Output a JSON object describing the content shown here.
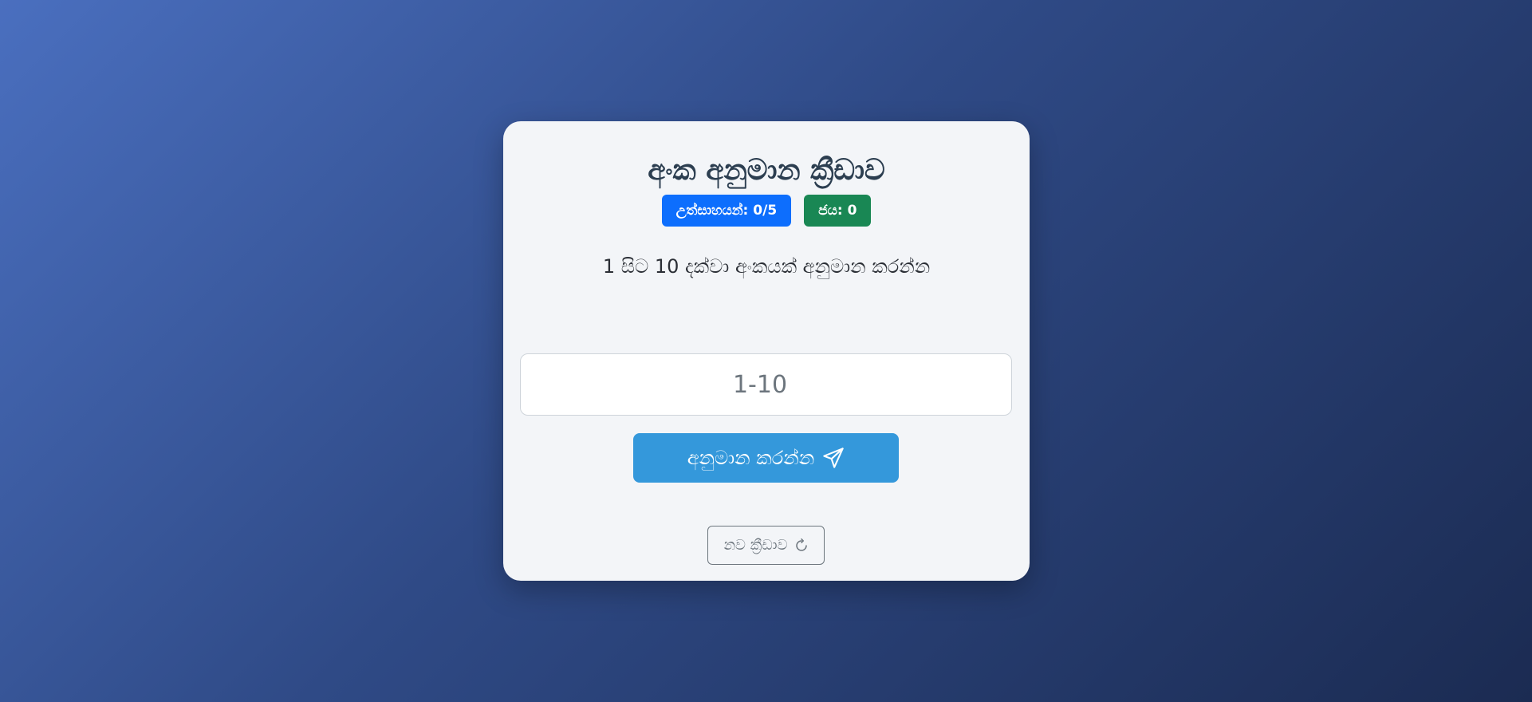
{
  "game": {
    "title": "අංක අනුමාන ක්‍රීඩාව",
    "attempts_label": "උත්සාහයන්: 0/5",
    "wins_label": "ජය: 0",
    "instruction": "1 සිට 10 දක්වා අංකයක් අනුමාන කරන්න",
    "input_placeholder": "1-10",
    "input_value": "",
    "guess_button_label": "අනුමාන කරන්න",
    "new_game_button_label": "නව ක්‍රීඩාව"
  },
  "icons": {
    "send": "send-icon",
    "reset": "refresh-icon"
  },
  "colors": {
    "attempts_badge": "#0d6efd",
    "wins_badge": "#198754",
    "guess_button": "#3498db",
    "card_background": "#f3f5f8",
    "title_text": "#2c3e50"
  }
}
